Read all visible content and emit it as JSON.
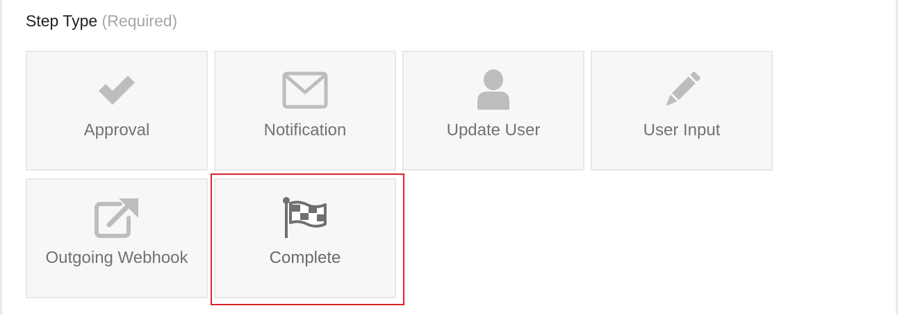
{
  "field": {
    "label": "Step Type",
    "required_text": "(Required)"
  },
  "step_types": [
    {
      "label": "Approval",
      "icon": "checkmark-icon",
      "selected": false
    },
    {
      "label": "Notification",
      "icon": "envelope-icon",
      "selected": false
    },
    {
      "label": "Update User",
      "icon": "user-icon",
      "selected": false
    },
    {
      "label": "User Input",
      "icon": "pencil-icon",
      "selected": false
    },
    {
      "label": "Outgoing Webhook",
      "icon": "external-link-icon",
      "selected": false
    },
    {
      "label": "Complete",
      "icon": "checkered-flag-icon",
      "selected": true
    }
  ],
  "colors": {
    "icon": "#bdbdbd",
    "icon_selected": "#6f6f6f",
    "highlight": "#d8232a",
    "tile_bg": "#f7f7f7"
  }
}
